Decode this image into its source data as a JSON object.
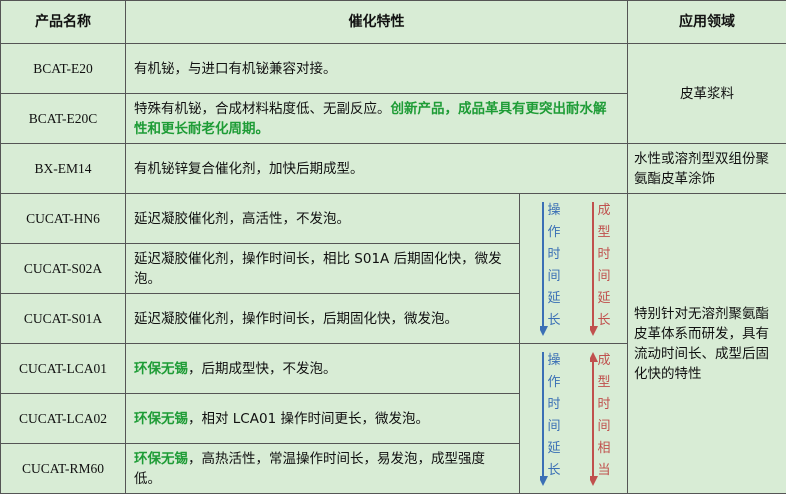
{
  "headers": {
    "name": "产品名称",
    "features": "催化特性",
    "application": "应用领域"
  },
  "rows": [
    {
      "name": "BCAT-E20",
      "desc": "有机铋，与进口有机铋兼容对接。"
    },
    {
      "name": "BCAT-E20C",
      "desc_plain": "特殊有机铋，合成材料粘度低、无副反应。",
      "desc_highlight": "创新产品，成品革具有更突出耐水解性和更长耐老化周期。"
    },
    {
      "name": "BX-EM14",
      "desc": "有机铋锌复合催化剂，加快后期成型。"
    },
    {
      "name": "CUCAT-HN6",
      "desc": "延迟凝胶催化剂，高活性，不发泡。"
    },
    {
      "name": "CUCAT-S02A",
      "desc": "延迟凝胶催化剂，操作时间长，相比 S01A 后期固化快，微发泡。"
    },
    {
      "name": "CUCAT-S01A",
      "desc": "延迟凝胶催化剂，操作时间长，后期固化快，微发泡。"
    },
    {
      "name": "CUCAT-LCA01",
      "desc_highlight": "环保无锡",
      "desc_plain": "，后期成型快，不发泡。"
    },
    {
      "name": "CUCAT-LCA02",
      "desc_highlight": "环保无锡",
      "desc_plain": "，相对 LCA01 操作时间更长，微发泡。"
    },
    {
      "name": "CUCAT-RM60",
      "desc_highlight": "环保无锡",
      "desc_plain": "，高热活性，常温操作时间长，易发泡，成型强度低。"
    }
  ],
  "applications": {
    "leather_slurry": "皮革浆料",
    "coating": "水性或溶剂型双组份聚氨酯皮革涂饰",
    "solventless": "特别针对无溶剂聚氨酯皮革体系而研发，具有流动时间长、成型后固化快的特性"
  },
  "arrows": {
    "group1": {
      "blue": [
        "操",
        "作",
        "时",
        "间",
        "延",
        "长"
      ],
      "red": [
        "成",
        "型",
        "时",
        "间",
        "延",
        "长"
      ]
    },
    "group2": {
      "blue": [
        "操",
        "作",
        "时",
        "间",
        "延",
        "长"
      ],
      "red": [
        "成",
        "型",
        "时",
        "间",
        "相",
        "当"
      ]
    }
  },
  "colors": {
    "background": "#d8ecd5",
    "highlight": "#1e9c36",
    "blue_arrow": "#3a6fb5",
    "red_arrow": "#c0504d",
    "border": "#555555"
  }
}
